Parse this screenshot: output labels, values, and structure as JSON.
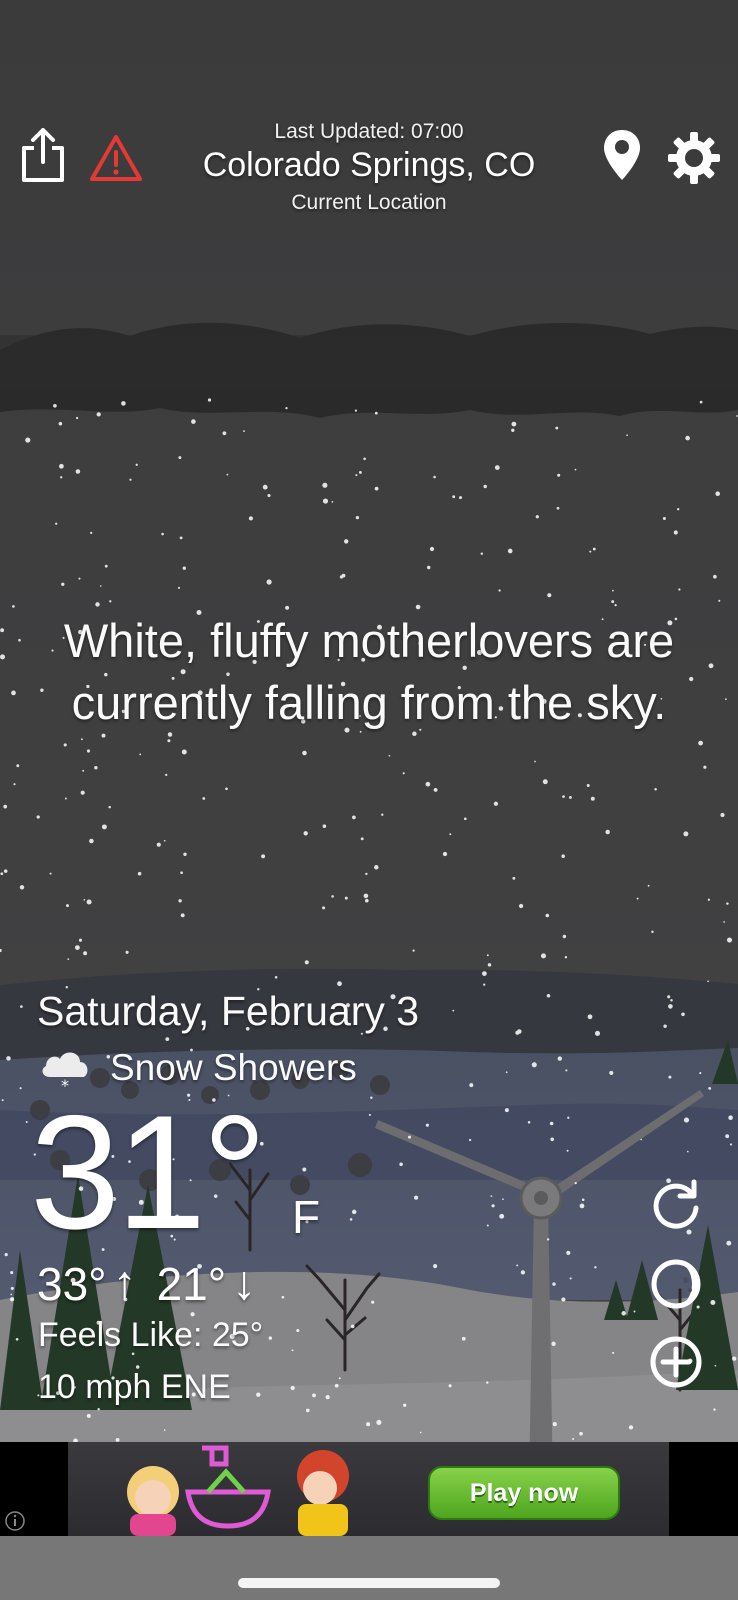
{
  "header": {
    "last_updated": "Last Updated: 07:00",
    "city": "Colorado Springs, CO",
    "location_label": "Current Location",
    "icons": [
      "share-icon",
      "alert-icon",
      "location-pin-icon",
      "gear-icon"
    ],
    "alert_color": "#e53935"
  },
  "message": {
    "line1": "White, fluffy motherlovers are",
    "line2": "currently falling from the sky."
  },
  "weather": {
    "date": "Saturday, February 3",
    "condition": "Snow Showers",
    "condition_icon": "snow-cloud-icon",
    "temperature": "31°",
    "unit": "F",
    "high": "33°",
    "high_arrow": "↑",
    "low": "21°",
    "low_arrow": "↓",
    "feels_like": "Feels Like: 25°",
    "wind": "10 mph ENE"
  },
  "side_controls": [
    "refresh-icon",
    "moon-icon",
    "add-icon"
  ],
  "ad": {
    "button_label": "Play now",
    "button_color": "#5cb82a",
    "info_icon": "info-icon"
  },
  "colors": {
    "sky": "#3c3c3d",
    "cloud_band": "#2a2a2b",
    "hills_far": "#4b5266",
    "snow_ground": "#8a8a8d",
    "tree_green": "#253a28"
  }
}
